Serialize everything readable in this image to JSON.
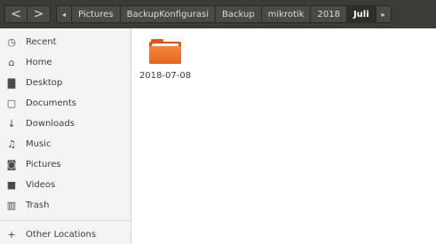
{
  "header": {
    "back_glyph": "<",
    "forward_glyph": ">",
    "path_left_arrow": "◂",
    "path_right_arrow": "▸",
    "path": [
      "Pictures",
      "BackupKonfigurasi",
      "Backup",
      "mikrotik",
      "2018",
      "Juli"
    ]
  },
  "sidebar": {
    "items": [
      {
        "label": "Recent",
        "icon": "clock-icon",
        "glyph": "◷"
      },
      {
        "label": "Home",
        "icon": "home-icon",
        "glyph": "⌂"
      },
      {
        "label": "Desktop",
        "icon": "folder-icon",
        "glyph": "▇"
      },
      {
        "label": "Documents",
        "icon": "document-icon",
        "glyph": "▢"
      },
      {
        "label": "Downloads",
        "icon": "download-icon",
        "glyph": "↓"
      },
      {
        "label": "Music",
        "icon": "music-icon",
        "glyph": "♫"
      },
      {
        "label": "Pictures",
        "icon": "camera-icon",
        "glyph": "◙"
      },
      {
        "label": "Videos",
        "icon": "video-icon",
        "glyph": "■"
      },
      {
        "label": "Trash",
        "icon": "trash-icon",
        "glyph": "▥"
      }
    ],
    "other_locations": {
      "label": "Other Locations",
      "icon": "plus-icon",
      "glyph": "+"
    }
  },
  "main": {
    "files": [
      {
        "name": "2018-07-08",
        "icon": "folder-icon"
      }
    ]
  },
  "colors": {
    "header_bg": "#3c3b37",
    "folder_accent": "#e8692a",
    "sidebar_bg": "#f5f4f2"
  }
}
